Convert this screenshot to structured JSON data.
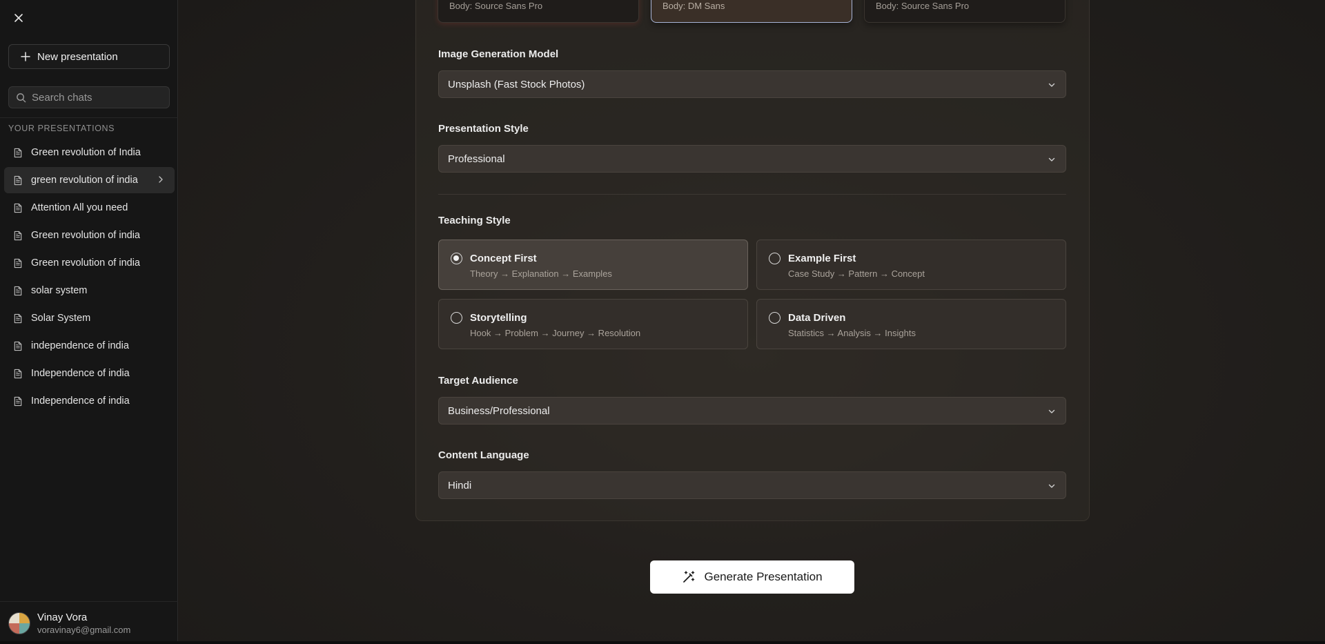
{
  "sidebar": {
    "new_button_label": "New presentation",
    "search_placeholder": "Search chats",
    "section_label": "YOUR PRESENTATIONS",
    "items": [
      {
        "label": "Green revolution of India"
      },
      {
        "label": "green revolution of india"
      },
      {
        "label": "Attention All you need"
      },
      {
        "label": "Green revolution of india"
      },
      {
        "label": "Green revolution of india"
      },
      {
        "label": "solar system"
      },
      {
        "label": "Solar System"
      },
      {
        "label": "independence of india"
      },
      {
        "label": "Independence of india"
      },
      {
        "label": "Independence of india"
      }
    ],
    "active_index": 1,
    "user": {
      "name": "Vinay Vora",
      "email": "voravinay6@gmail.com"
    }
  },
  "font_cards": [
    {
      "body": "Body: Source Sans Pro"
    },
    {
      "body": "Body: DM Sans"
    },
    {
      "body": "Body: Source Sans Pro"
    }
  ],
  "form": {
    "image_model": {
      "label": "Image Generation Model",
      "value": "Unsplash (Fast Stock Photos)"
    },
    "presentation_style": {
      "label": "Presentation Style",
      "value": "Professional"
    },
    "teaching_style": {
      "label": "Teaching Style",
      "options": [
        {
          "title": "Concept First",
          "subtitle": "Theory → Explanation → Examples",
          "selected": true
        },
        {
          "title": "Example First",
          "subtitle": "Case Study → Pattern → Concept",
          "selected": false
        },
        {
          "title": "Storytelling",
          "subtitle": "Hook → Problem → Journey → Resolution",
          "selected": false
        },
        {
          "title": "Data Driven",
          "subtitle": "Statistics → Analysis → Insights",
          "selected": false
        }
      ]
    },
    "target_audience": {
      "label": "Target Audience",
      "value": "Business/Professional"
    },
    "content_language": {
      "label": "Content Language",
      "value": "Hindi"
    }
  },
  "generate_button_label": "Generate Presentation",
  "icons": {
    "close": "close-icon",
    "plus": "plus-icon",
    "search": "search-icon",
    "document": "document-icon",
    "chevron_right": "chevron-right-icon",
    "chevron_down": "chevron-down-icon",
    "magic_wand": "magic-wand-icon"
  }
}
